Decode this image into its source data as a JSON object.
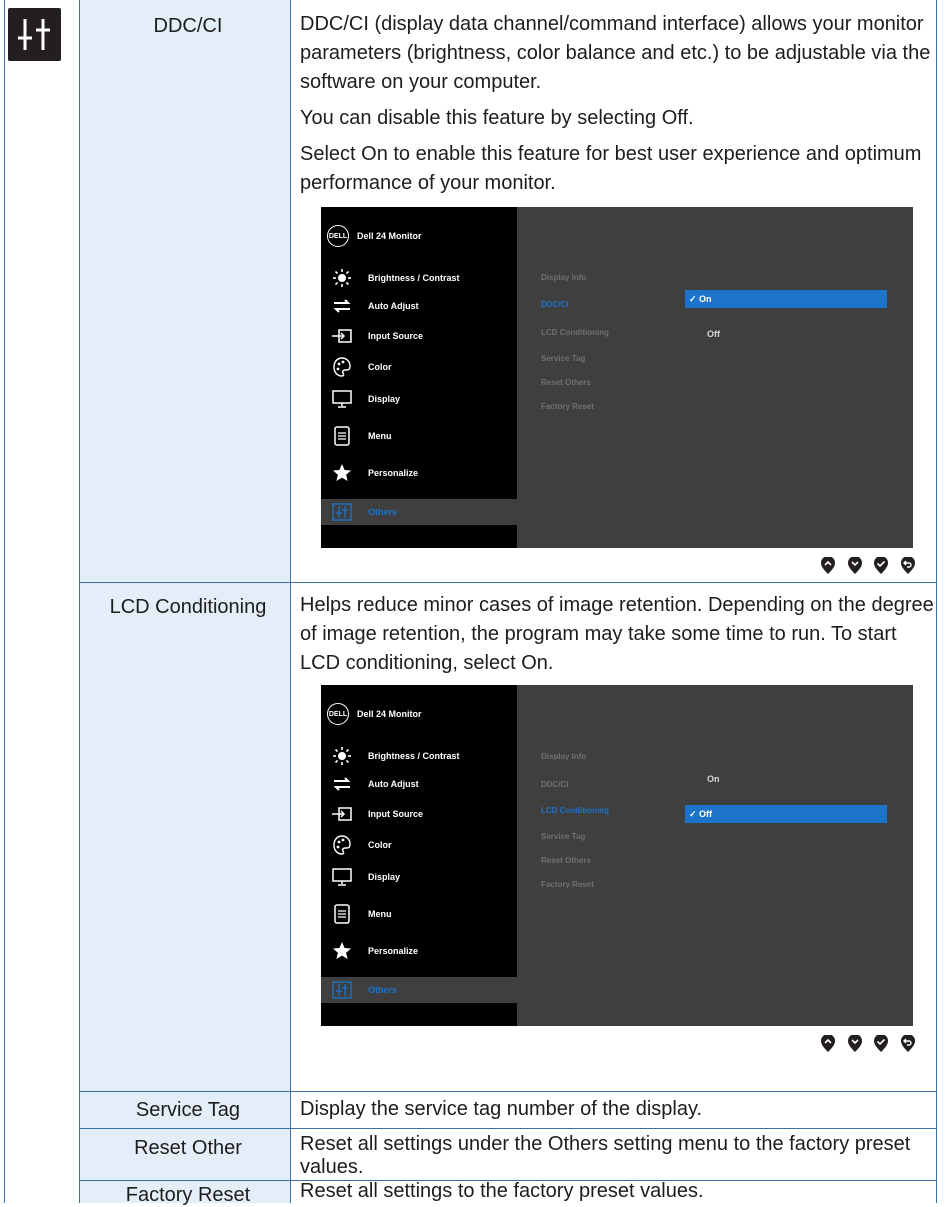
{
  "sections": {
    "ddcci": {
      "label": "DDC/CI",
      "paragraphs": [
        "DDC/CI (display data channel/command interface) allows your monitor parameters (brightness, color balance and etc.) to be adjustable via the software on your computer.",
        "You can disable this feature by selecting Off.",
        "Select On to enable this feature for best user experience and optimum performance of your monitor."
      ]
    },
    "lcd": {
      "label": "LCD Conditioning",
      "paragraph": "Helps reduce minor cases of image retention. Depending on the degree of image retention, the program may take some time to run. To start LCD conditioning, select On."
    },
    "service_tag": {
      "label": "Service Tag",
      "paragraph": "Display the service tag number of the display."
    },
    "reset_other": {
      "label": "Reset Other",
      "paragraph_before": "Reset all settings under the ",
      "paragraph_bold": "Others",
      "paragraph_after": " setting menu to the factory preset values."
    },
    "factory_reset": {
      "label": "Factory Reset",
      "paragraph": "Reset all settings to the factory preset values."
    }
  },
  "osd": {
    "brand_logo": "DELL",
    "model": "Dell 24 Monitor",
    "menu": [
      {
        "label": "Brightness / Contrast",
        "icon": "brightness-icon"
      },
      {
        "label": "Auto Adjust",
        "icon": "auto-adjust-icon"
      },
      {
        "label": "Input Source",
        "icon": "input-source-icon"
      },
      {
        "label": "Color",
        "icon": "color-icon"
      },
      {
        "label": "Display",
        "icon": "display-icon"
      },
      {
        "label": "Menu",
        "icon": "menu-icon"
      },
      {
        "label": "Personalize",
        "icon": "star-icon"
      },
      {
        "label": "Others",
        "icon": "others-icon"
      }
    ],
    "submenu": [
      "Display Info",
      "DDC/CI",
      "LCD Conditioning",
      "Service Tag",
      "Reset Others",
      "Factory Reset"
    ],
    "osd1_options": [
      "✓ On",
      "Off"
    ],
    "osd2_options": [
      "On",
      "✓ Off"
    ]
  },
  "colors": {
    "grid": "#3a6fa8",
    "shade": "#e4eef9",
    "accent": "#1b74c9",
    "osd_panel": "#3f3f3f"
  }
}
